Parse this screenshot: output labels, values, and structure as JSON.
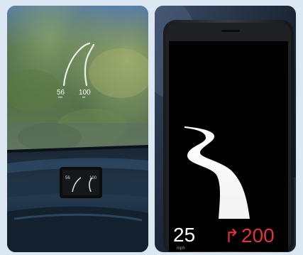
{
  "left_photo": {
    "hud_speed": "56",
    "hud_distance": "100",
    "phone_speed": "56",
    "phone_distance": "100"
  },
  "right_photo": {
    "speed": "25",
    "speed_unit": "mph",
    "turn_arrow": "↱",
    "distance": "200"
  },
  "colors": {
    "background": "#dbe8f4",
    "accent_red": "#e0323c",
    "phone_body": "#2a2b2e"
  }
}
